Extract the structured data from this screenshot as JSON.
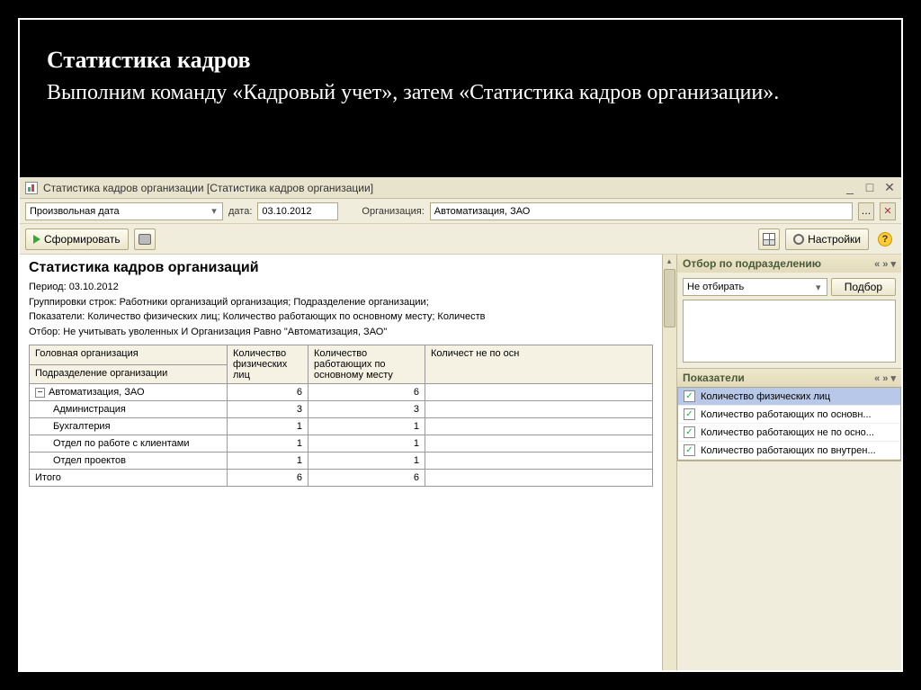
{
  "slide": {
    "title": "Статистика кадров",
    "text": "Выполним команду «Кадровый учет», затем «Статистика кадров организации»."
  },
  "window": {
    "title": "Статистика кадров организации [Статистика кадров организации]"
  },
  "toolbar1": {
    "period_mode": "Произвольная дата",
    "date_label": "дата:",
    "date_value": "03.10.2012",
    "org_label": "Организация:",
    "org_value": "Автоматизация, ЗАО"
  },
  "toolbar2": {
    "form_btn": "Сформировать",
    "settings_btn": "Настройки"
  },
  "report": {
    "title": "Статистика кадров организаций",
    "period": "Период: 03.10.2012",
    "groupings": "Группировки строк: Работники организаций организация; Подразделение организации;",
    "indicators": "Показатели: Количество физических лиц; Количество работающих по основному месту; Количеств",
    "filter": "Отбор: Не учитывать уволенных И Организация Равно \"Автоматизация, ЗАО\"",
    "headers": {
      "h1a": "Головная организация",
      "h1b": "Подразделение организации",
      "h2": "Количество физических лиц",
      "h3": "Количество работающих по основному месту",
      "h4": "Количест не по осн"
    },
    "rows": [
      {
        "label": "Автоматизация, ЗАО",
        "c1": "6",
        "c2": "6",
        "tree": true,
        "indent": 0
      },
      {
        "label": "Администрация",
        "c1": "3",
        "c2": "3",
        "indent": 1
      },
      {
        "label": "Бухгалтерия",
        "c1": "1",
        "c2": "1",
        "indent": 1
      },
      {
        "label": "Отдел по работе с клиентами",
        "c1": "1",
        "c2": "1",
        "indent": 1
      },
      {
        "label": "Отдел проектов",
        "c1": "1",
        "c2": "1",
        "indent": 1
      }
    ],
    "total_label": "Итого",
    "total_c1": "6",
    "total_c2": "6"
  },
  "side": {
    "panel1_title": "Отбор по подразделению",
    "filter_mode": "Не отбирать",
    "pick_btn": "Подбор",
    "panel2_title": "Показатели",
    "indicators": [
      "Количество физических лиц",
      "Количество работающих по основн...",
      "Количество работающих не по осно...",
      "Количество работающих по внутрен..."
    ],
    "chevrons": "« » ▾"
  }
}
